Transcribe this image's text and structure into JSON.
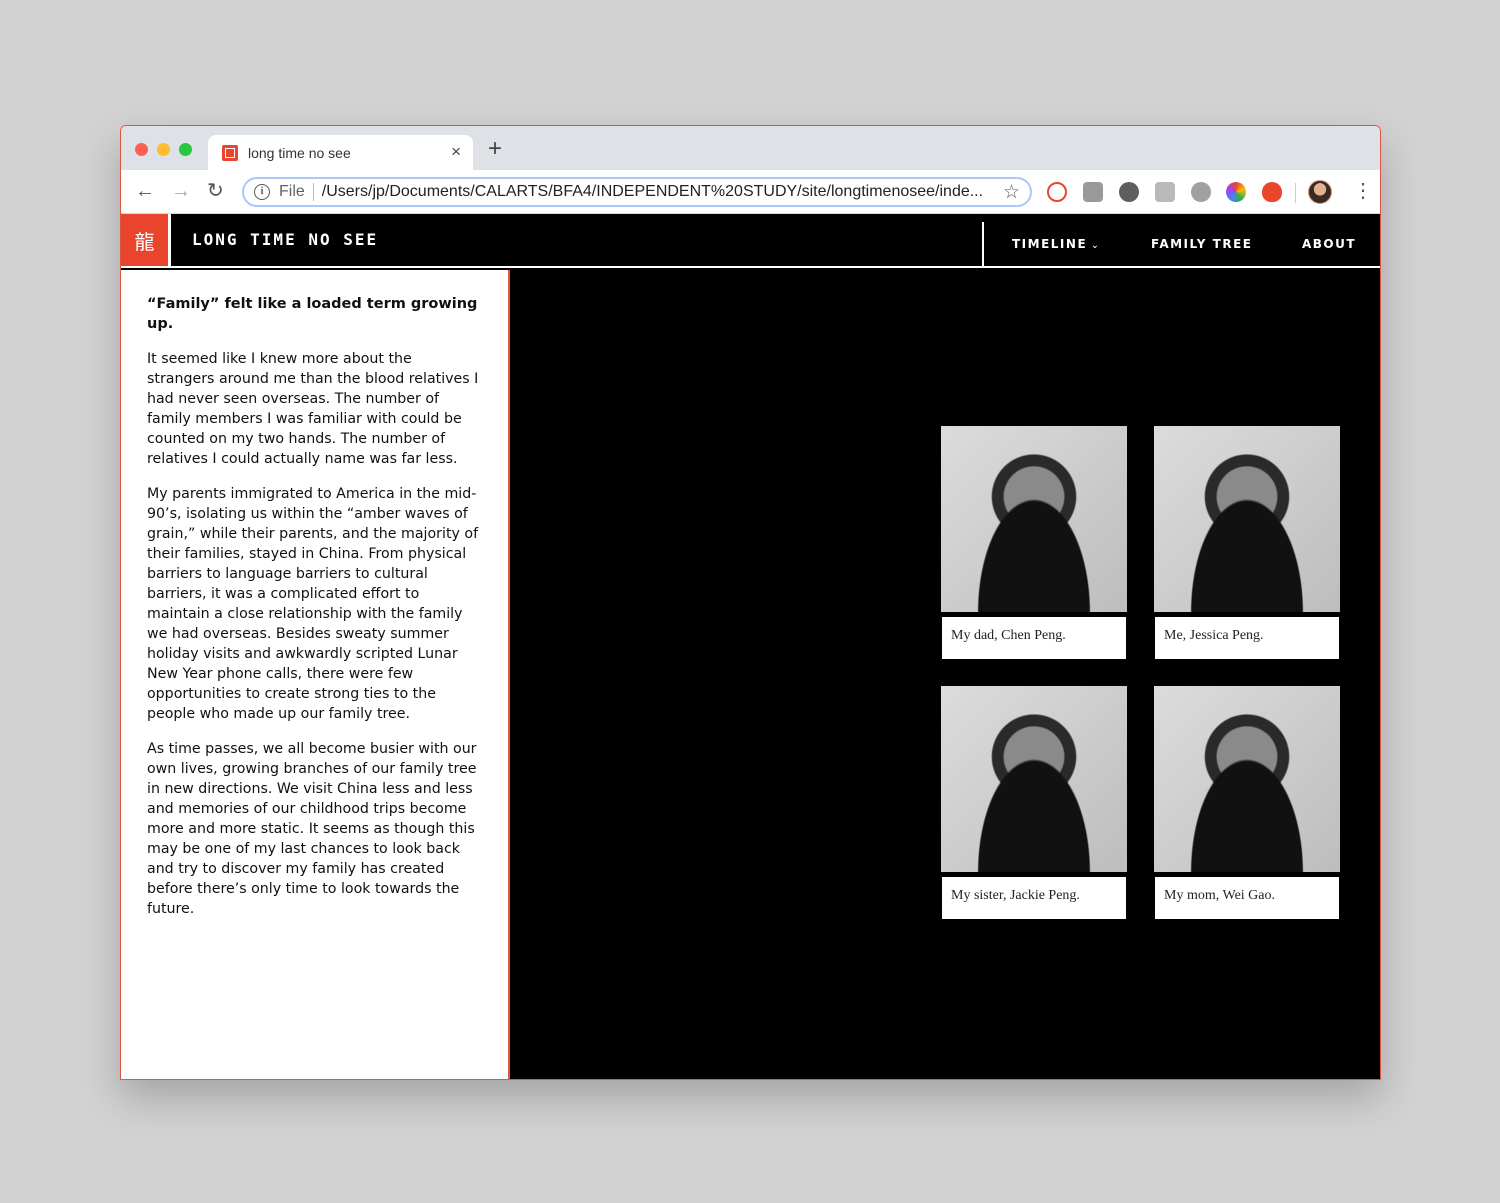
{
  "browser": {
    "tab_title": "long time no see",
    "tab_close": "×",
    "new_tab": "+",
    "scheme": "File",
    "url": "/Users/jp/Documents/CALARTS/BFA4/INDEPENDENT%20STUDY/site/longtimenosee/inde...",
    "icons": [
      "back-arrow-icon",
      "forward-arrow-icon",
      "reload-icon",
      "info-icon",
      "star-icon",
      "kebab-menu-icon"
    ]
  },
  "site": {
    "logo_glyph": "龍",
    "title": "LONG TIME NO SEE",
    "nav": {
      "timeline": "TIMELINE",
      "family_tree": "FAMILY TREE",
      "about": "ABOUT"
    },
    "accent_color": "#e8452c"
  },
  "content": {
    "lead": "“Family” felt like a loaded term growing up.",
    "paragraphs": [
      "It seemed like I knew more about the strangers around me than the blood relatives I had never seen overseas. The number of family members I was familiar with could be counted on my two hands. The number of relatives I could actually name was far less.",
      "My parents immigrated to America in the mid-90’s, isolating us within the “amber waves of grain,” while their parents, and the majority of their families, stayed in China. From physical barriers to language barriers to cultural barriers, it was a complicated effort to maintain a close relationship with the family we had overseas. Besides sweaty summer holiday visits and awkwardly scripted Lunar New Year phone calls, there were few opportunities to create strong ties to the people who made up our family tree.",
      "As time passes, we all become busier with our own lives, growing branches of our family tree in new directions. We visit China less and less and memories of our childhood trips become more and more static. It seems as though this may be one of my last chances to look back and try to discover my family has created before there’s only time to look towards the future."
    ]
  },
  "gallery": [
    {
      "caption": "My dad, Chen Peng."
    },
    {
      "caption": "Me, Jessica Peng."
    },
    {
      "caption": "My sister, Jackie Peng."
    },
    {
      "caption": "My mom, Wei Gao."
    }
  ]
}
